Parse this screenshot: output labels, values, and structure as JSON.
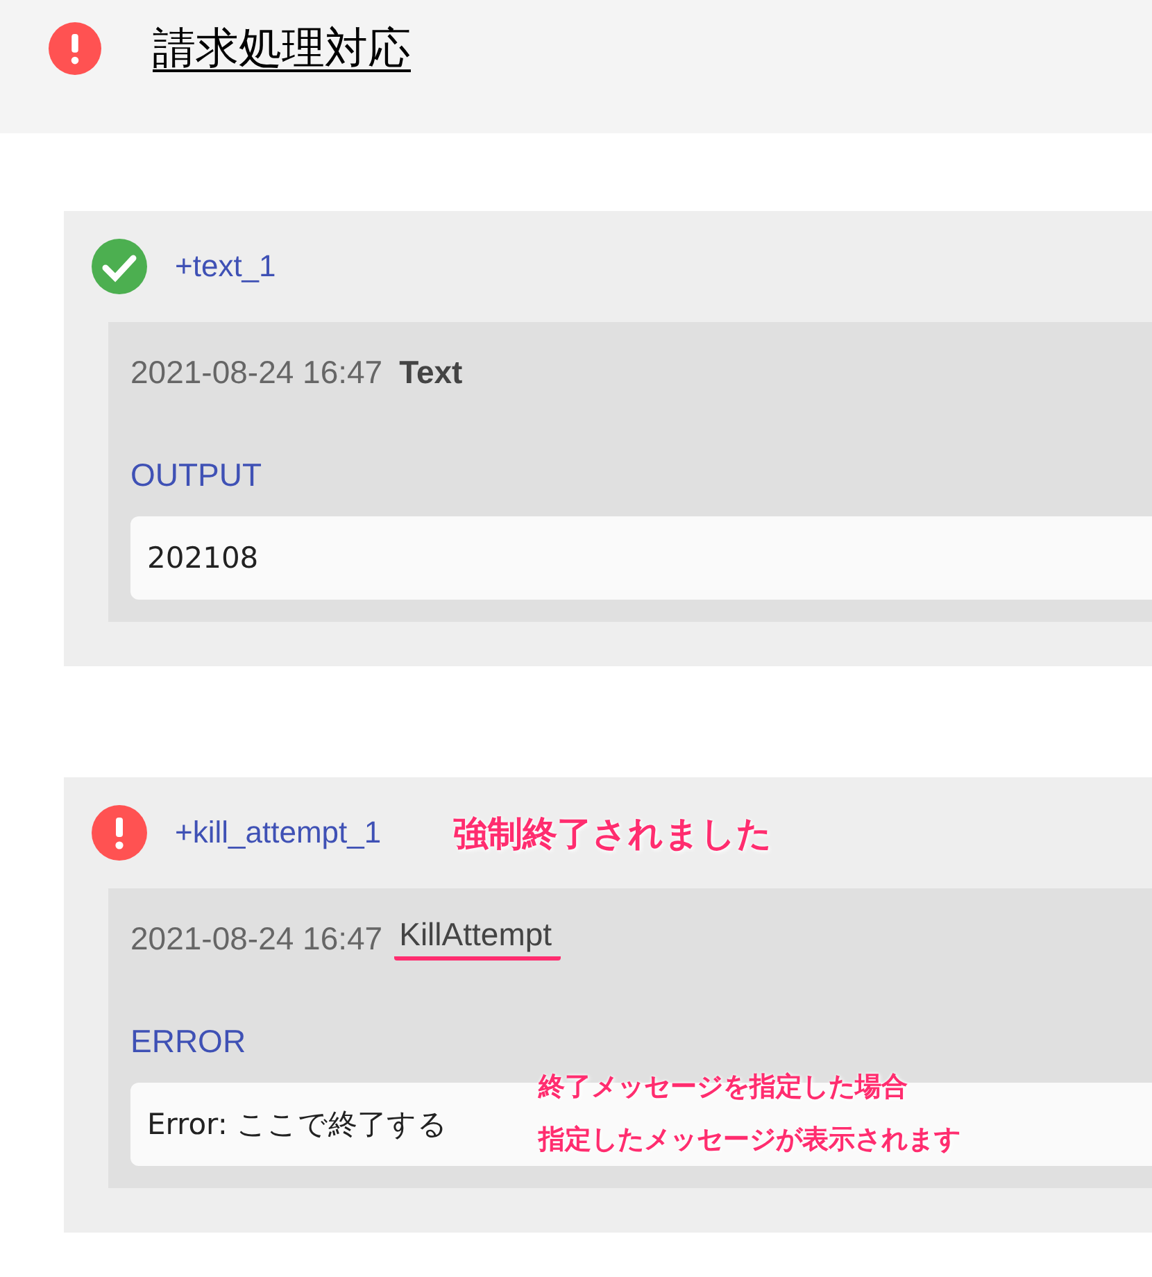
{
  "header": {
    "kind": "error",
    "title": "請求処理対応"
  },
  "steps": [
    {
      "kind": "success",
      "name": "+text_1",
      "timestamp": "2021-08-24 16:47",
      "type": "Text",
      "type_marked": false,
      "section_label": "OUTPUT",
      "content": "202108"
    },
    {
      "kind": "error",
      "name": "+kill_attempt_1",
      "callout": "強制終了されました",
      "timestamp": "2021-08-24 16:47",
      "type": "KillAttempt",
      "type_marked": true,
      "section_label": "ERROR",
      "content": "Error: ここで終了する",
      "note_lines": [
        "終了メッセージを指定した場合",
        "指定したメッセージが表示されます"
      ]
    }
  ]
}
